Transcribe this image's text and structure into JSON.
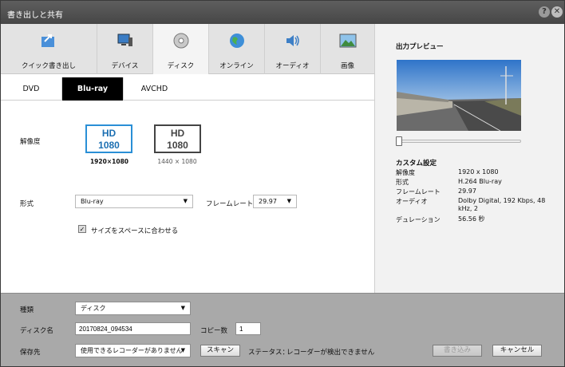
{
  "window": {
    "title": "書き出しと共有",
    "help_glyph": "?",
    "close_glyph": "✕"
  },
  "main_tabs": [
    {
      "label": "クイック書き出し",
      "icon": "quick-export-icon"
    },
    {
      "label": "デバイス",
      "icon": "device-icon"
    },
    {
      "label": "ディスク",
      "icon": "disc-icon"
    },
    {
      "label": "オンライン",
      "icon": "globe-icon"
    },
    {
      "label": "オーディオ",
      "icon": "speaker-icon"
    },
    {
      "label": "画像",
      "icon": "picture-icon"
    }
  ],
  "selected_main_tab": "ディスク",
  "sub_tabs": [
    "DVD",
    "Blu-ray",
    "AVCHD"
  ],
  "selected_sub_tab": "Blu-ray",
  "resolution": {
    "label": "解像度",
    "options": [
      {
        "line1": "HD",
        "line2": "1080",
        "caption": "1920×1080"
      },
      {
        "line1": "HD",
        "line2": "1080",
        "caption": "1440 × 1080"
      }
    ]
  },
  "format": {
    "label": "形式",
    "value": "Blu-ray"
  },
  "framerate": {
    "label": "フレームレート",
    "value": "29.97"
  },
  "fit_option": {
    "label": "サイズをスペースに合わせる",
    "checked": true
  },
  "preview": {
    "title": "出力プレビュー",
    "slider_position": 0.0
  },
  "custom_settings": {
    "title": "カスタム設定",
    "rows": [
      {
        "key": "解像度",
        "value": "1920 x 1080"
      },
      {
        "key": "形式",
        "value": "H.264 Blu-ray"
      },
      {
        "key": "フレームレート",
        "value": "29.97"
      },
      {
        "key": "オーディオ",
        "value": "Dolby Digital, 192 Kbps, 48 kHz, 2"
      },
      {
        "key": "デュレーション",
        "value": "56.56 秒"
      }
    ]
  },
  "bottom": {
    "type_label": "種類",
    "type_value": "ディスク",
    "disc_name_label": "ディスク名",
    "disc_name_value": "20170824_094534",
    "copies_label": "コピー数",
    "copies_value": "1",
    "save_to_label": "保存先",
    "save_to_value": "使用できるレコーダーがありません",
    "scan_label": "スキャン",
    "status_label": "ステータス：",
    "status_value": "レコーダーが検出できません",
    "write_label": "書き込み",
    "cancel_label": "キャンセル"
  },
  "colors": {
    "accent": "#2a8fd6",
    "title_bar": "#4e4e4e",
    "bottom_panel": "#a9a9a9"
  }
}
